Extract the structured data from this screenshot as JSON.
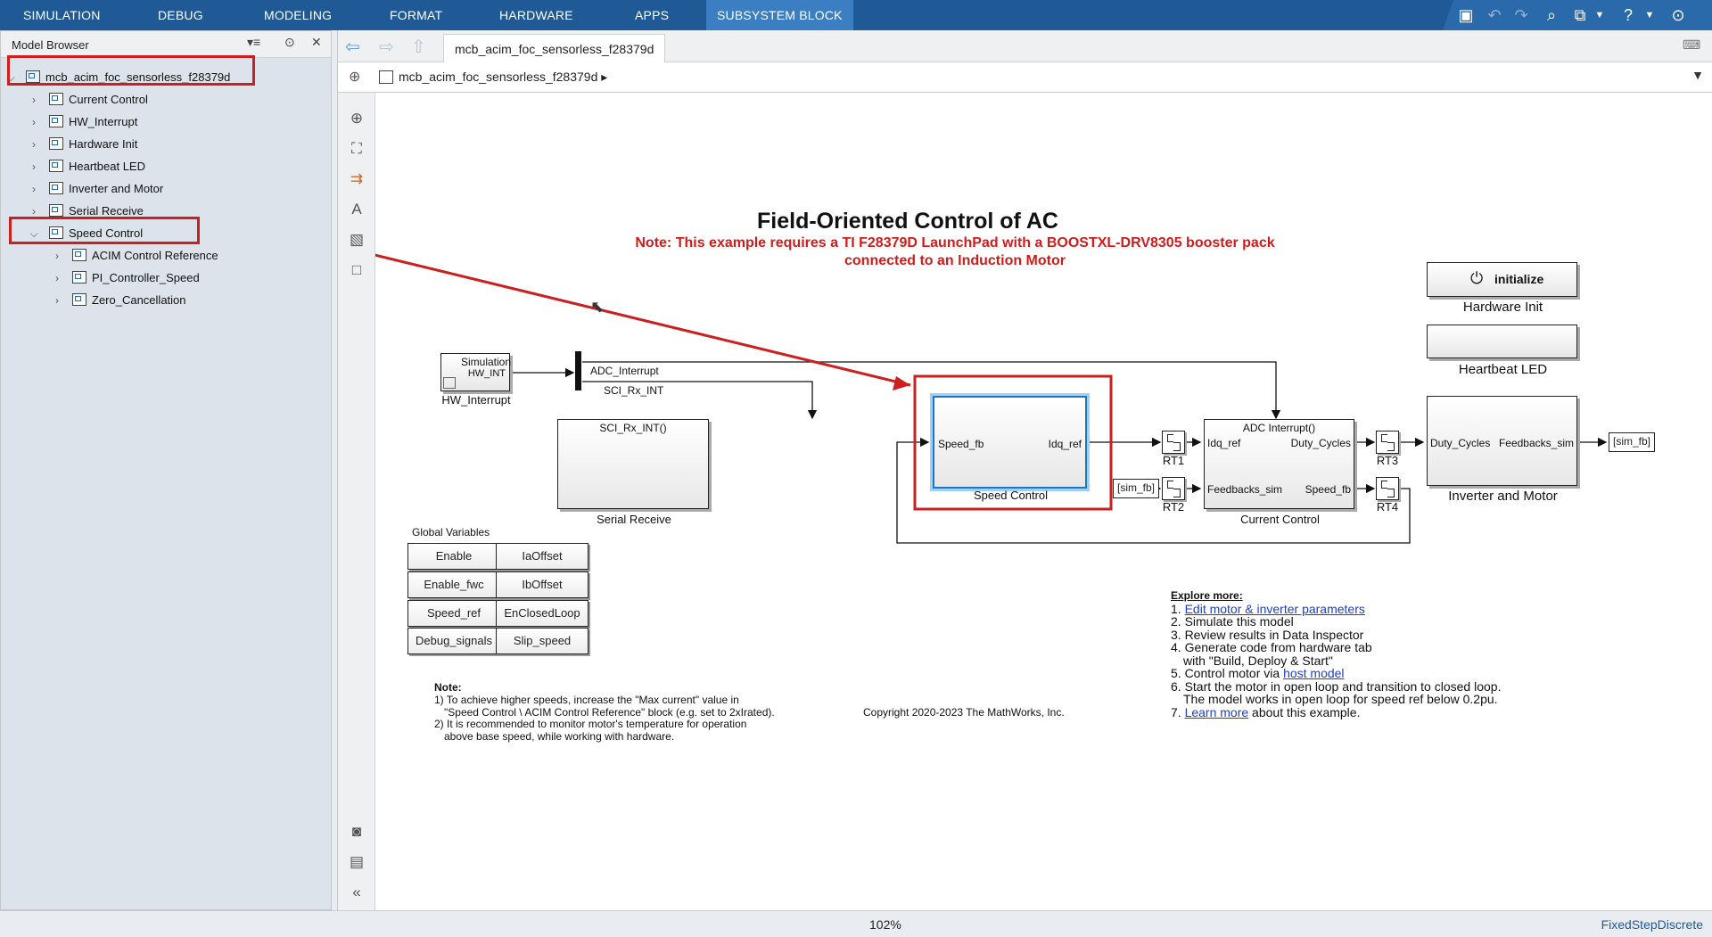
{
  "toolstrip": {
    "tabs": [
      "SIMULATION",
      "DEBUG",
      "MODELING",
      "FORMAT",
      "HARDWARE",
      "APPS",
      "SUBSYSTEM BLOCK"
    ],
    "active_tab": "SUBSYSTEM BLOCK"
  },
  "model_browser": {
    "title": "Model Browser",
    "root": "mcb_acim_foc_sensorless_f28379d",
    "children": [
      "Current Control",
      "HW_Interrupt",
      "Hardware Init",
      "Heartbeat LED",
      "Inverter and Motor",
      "Serial Receive",
      "Speed Control"
    ],
    "speed_control_children": [
      "ACIM Control Reference",
      "PI_Controller_Speed",
      "Zero_Cancellation"
    ]
  },
  "editor": {
    "tab_label": "mcb_acim_foc_sensorless_f28379d",
    "breadcrumb": "mcb_acim_foc_sensorless_f28379d"
  },
  "diagram": {
    "title": "Field-Oriented Control of AC",
    "note_line1": "Note: This example requires a TI F28379D LaunchPad with a BOOSTXL-DRV8305 booster pack",
    "note_line2": "connected to an Induction Motor",
    "hw_interrupt": {
      "inner_title": "Simulation",
      "port": "HW_INT",
      "label": "HW_Interrupt"
    },
    "mux_signals": {
      "adc": "ADC_Interrupt",
      "sci": "SCI_Rx_INT"
    },
    "serial_receive": {
      "trigger": "SCI_Rx_INT()",
      "label": "Serial Receive"
    },
    "speed_control": {
      "in_port": "Speed_fb",
      "out_port": "Idq_ref",
      "label": "Speed Control"
    },
    "goto_in": "[sim_fb]",
    "goto_out": "[sim_fb]",
    "rt_labels": [
      "RT1",
      "RT2",
      "RT3",
      "RT4"
    ],
    "current_control": {
      "trigger": "ADC Interrupt()",
      "in1": "Idq_ref",
      "in2": "Feedbacks_sim",
      "out1": "Duty_Cycles",
      "out2": "Speed_fb",
      "label": "Current Control"
    },
    "inverter_motor": {
      "in1": "Duty_Cycles",
      "out1": "Feedbacks_sim",
      "label": "Inverter and Motor"
    },
    "hardware_init": {
      "button": "initialize",
      "label": "Hardware Init"
    },
    "heartbeat_label": "Heartbeat LED",
    "global_vars": {
      "title": "Global Variables",
      "buttons": [
        "Enable",
        "IaOffset",
        "Enable_fwc",
        "IbOffset",
        "Speed_ref",
        "EnClosedLoop",
        "Debug_signals",
        "Slip_speed"
      ]
    },
    "bottom_note": {
      "heading": "Note:",
      "l1": "1) To achieve higher speeds, increase the \"Max current\" value in",
      "l2": "\"Speed Control \\ ACIM Control Reference\" block (e.g. set to 2xIrated).",
      "l3": "2) It is recommended to monitor motor's temperature for operation",
      "l4": "above base speed, while working with hardware."
    },
    "copyright": "Copyright 2020-2023 The MathWorks, Inc.",
    "explore": {
      "heading": "Explore more:",
      "i1_num": "1.",
      "i1_link": "Edit motor & inverter parameters",
      "i2": "2. Simulate this model",
      "i3": "3. Review results in Data Inspector",
      "i4a": "4. Generate code from hardware tab",
      "i4b": "with \"Build, Deploy & Start\"",
      "i5_pre": "5. Control motor via ",
      "i5_link": "host model",
      "i6a": "6. Start the motor in open loop and transition to closed loop.",
      "i6b": "The model works in open loop for speed ref below 0.2pu.",
      "i7_num": "7. ",
      "i7_link": "Learn more",
      "i7_post": " about this example."
    }
  },
  "status": {
    "zoom": "102%",
    "solver": "FixedStepDiscrete"
  },
  "colors": {
    "toolstrip": "#1f5a97",
    "highlight": "#cc1f1f",
    "selection": "#1b78c2"
  }
}
